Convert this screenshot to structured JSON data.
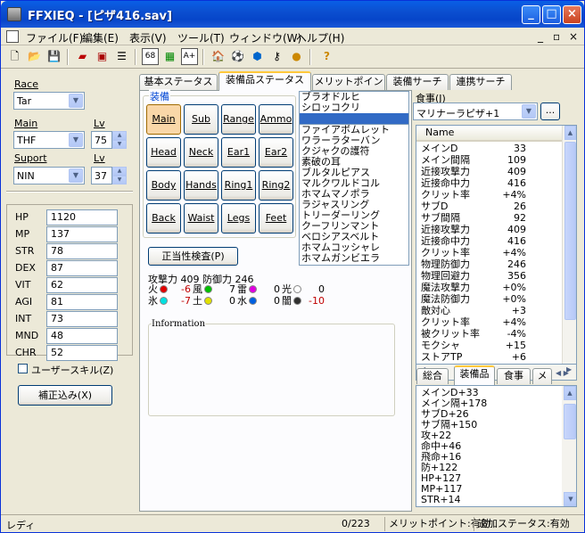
{
  "window": {
    "title": "FFXIEQ - [ピザ416.sav]"
  },
  "menu": [
    "ファイル(F)",
    "編集(E)",
    "表示(V)",
    "ツール(T)",
    "ウィンドウ(W)",
    "ヘルプ(H)"
  ],
  "toolbar": {
    "icons": [
      "new-icon",
      "open-icon",
      "save-icon",
      "book-red-icon",
      "book-check-icon",
      "list-icon",
      "68-icon",
      "chart-icon",
      "a-plus-icon",
      "house-icon",
      "ball-icon",
      "globe-icon",
      "key-icon",
      "food-icon",
      "help-icon"
    ],
    "labels": {
      "t68": "68",
      "aplus": "A+",
      "help": "?"
    }
  },
  "left": {
    "race_label": "Race",
    "race_value": "Tar",
    "main_label": "Main",
    "main_value": "THF",
    "lv_label": "Lv",
    "main_lv": "75",
    "support_label": "Suport",
    "support_value": "NIN",
    "support_lv": "37",
    "stats": [
      {
        "k": "HP",
        "v": "1120"
      },
      {
        "k": "MP",
        "v": "137"
      },
      {
        "k": "STR",
        "v": "78"
      },
      {
        "k": "DEX",
        "v": "87"
      },
      {
        "k": "VIT",
        "v": "62"
      },
      {
        "k": "AGI",
        "v": "81"
      },
      {
        "k": "INT",
        "v": "73"
      },
      {
        "k": "MND",
        "v": "48"
      },
      {
        "k": "CHR",
        "v": "52"
      }
    ],
    "user_skill": "ユーザースキル(Z)",
    "correction_button": "補正込み(X)"
  },
  "tabs": [
    "基本ステータス",
    "装備品ステータス",
    "メリットポイント",
    "装備サーチ",
    "連携サーチ"
  ],
  "equip": {
    "group_label": "装備",
    "slots": [
      "Main",
      "Sub",
      "Range",
      "Ammo",
      "Head",
      "Neck",
      "Ear1",
      "Ear2",
      "Body",
      "Hands",
      "Ring1",
      "Ring2",
      "Back",
      "Waist",
      "Legs",
      "Feet"
    ],
    "check_button": "正当性検査(P)",
    "attack_line": "攻撃力 409 防御力 246",
    "elements": [
      {
        "k": "火",
        "v": "-6",
        "neg": true,
        "c": "#e00000"
      },
      {
        "k": "風",
        "v": "7",
        "c": "#00c000"
      },
      {
        "k": "雷",
        "v": "0",
        "c": "#e000e0"
      },
      {
        "k": "光",
        "v": "0",
        "c": "#ffffff"
      },
      {
        "k": "氷",
        "v": "-7",
        "neg": true,
        "c": "#00e0e0"
      },
      {
        "k": "土",
        "v": "0",
        "c": "#e0e000"
      },
      {
        "k": "水",
        "v": "0",
        "c": "#0060e0"
      },
      {
        "k": "闇",
        "v": "-10",
        "neg": true,
        "c": "#303030"
      }
    ],
    "info_label": "Information"
  },
  "item_list_top": [
    "ブラオドルヒ",
    "シロッコクリ",
    ""
  ],
  "item_list": [
    "ファイアボムレット",
    "ワラーラターバン",
    "クジャクの護符",
    "素破の耳",
    "ブルタルピアス",
    "マルクワルドコル",
    "ホマムマノポラ",
    "ラジャスリング",
    "トリーダーリング",
    "クーフリンマント",
    "ベロシアスベルト",
    "ホマムコッシャレ",
    "ホマムガンビエラ"
  ],
  "food": {
    "label": "食事(J)",
    "value": "マリナーラピザ+1",
    "btn": "...",
    "col_name": "Name",
    "rows": [
      {
        "k": "メインD",
        "v": "33"
      },
      {
        "k": "メイン間隔",
        "v": "109"
      },
      {
        "k": "近接攻撃力",
        "v": "409"
      },
      {
        "k": "近接命中力",
        "v": "416"
      },
      {
        "k": "クリット率",
        "v": "+4%"
      },
      {
        "k": "サブD",
        "v": "26"
      },
      {
        "k": "サブ間隔",
        "v": "92"
      },
      {
        "k": "近接攻撃力",
        "v": "409"
      },
      {
        "k": "近接命中力",
        "v": "416"
      },
      {
        "k": "クリット率",
        "v": "+4%"
      },
      {
        "k": "物理防御力",
        "v": "246"
      },
      {
        "k": "物理回避力",
        "v": "356"
      },
      {
        "k": "魔法攻撃力",
        "v": "+0%"
      },
      {
        "k": "魔法防御力",
        "v": "+0%"
      },
      {
        "k": "敵対心",
        "v": "+3"
      },
      {
        "k": "クリット率",
        "v": "+4%"
      },
      {
        "k": "被クリット率",
        "v": "-4%"
      },
      {
        "k": "モクシャ",
        "v": "+15"
      },
      {
        "k": "ストアTP",
        "v": "+6"
      }
    ]
  },
  "bottom_tabs": [
    "総合",
    "装備品",
    "食事",
    "メ"
  ],
  "bottom_list": [
    "メインD+33",
    "メイン隔+178",
    "サブD+26",
    "サブ隔+150",
    "攻+22",
    "命中+46",
    "飛命+16",
    "防+122",
    "HP+127",
    "MP+117",
    "STR+14"
  ],
  "status": {
    "ready": "レディ",
    "count": "0/223",
    "merit": "メリットポイント:有効",
    "extra": "追加ステータス:有効"
  }
}
